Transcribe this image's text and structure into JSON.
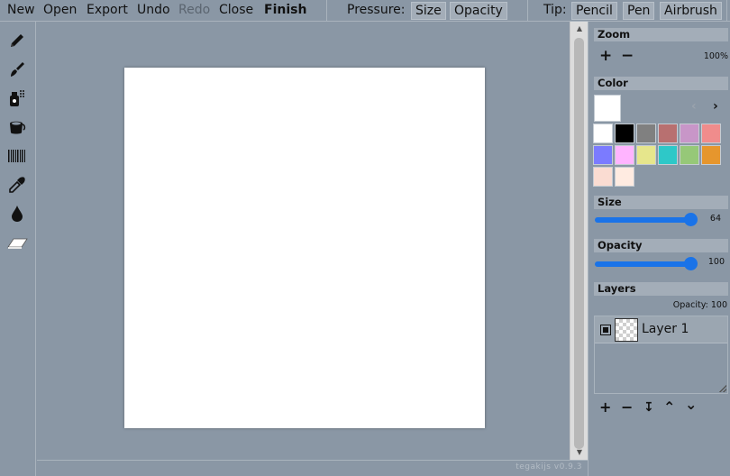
{
  "menu": {
    "new": "New",
    "open": "Open",
    "export": "Export",
    "undo": "Undo",
    "redo": "Redo",
    "close": "Close",
    "finish": "Finish"
  },
  "pressure": {
    "label": "Pressure:",
    "size": "Size",
    "opacity": "Opacity"
  },
  "tip": {
    "label": "Tip:",
    "options": [
      "Pencil",
      "Pen",
      "Airbrush"
    ],
    "selected": "Pencil"
  },
  "tools": [
    "pencil-icon",
    "brush-icon",
    "spray-can-icon",
    "bucket-icon",
    "pattern-icon",
    "eyedropper-icon",
    "ink-drop-icon",
    "eraser-icon"
  ],
  "panel": {
    "zoom": {
      "title": "Zoom",
      "value": "100%"
    },
    "color": {
      "title": "Color",
      "current": "#ffffff",
      "swatches": [
        "#ffffff",
        "#000000",
        "#808080",
        "#b87070",
        "#c896c8",
        "#f08c8c",
        "#7b7bff",
        "#ffb4ff",
        "#e6e68c",
        "#2ec8c8",
        "#96c878",
        "#e6962d",
        "#fadcd2",
        "#ffebe1"
      ]
    },
    "size": {
      "title": "Size",
      "value": "64"
    },
    "opacity": {
      "title": "Opacity",
      "value": "100"
    },
    "layers": {
      "title": "Layers",
      "opacity_label": "Opacity: 100",
      "items": [
        {
          "name": "Layer 1"
        }
      ]
    }
  },
  "version": "tegakijs v0.9.3",
  "colors": {
    "background": "#8a97a5",
    "accent": "#1a73e8"
  }
}
